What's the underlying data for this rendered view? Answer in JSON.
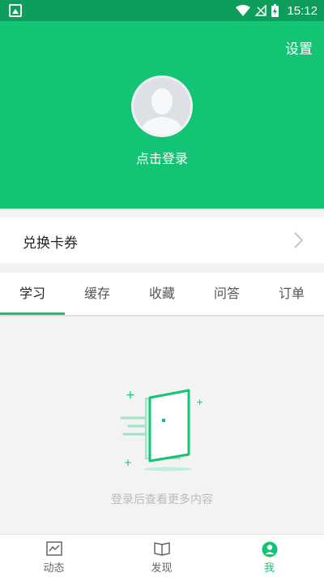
{
  "status_bar": {
    "time": "15:12"
  },
  "header": {
    "settings_label": "设置",
    "login_label": "点击登录"
  },
  "coupon": {
    "label": "兑换卡券"
  },
  "tabs": [
    {
      "label": "学习"
    },
    {
      "label": "缓存"
    },
    {
      "label": "收藏"
    },
    {
      "label": "问答"
    },
    {
      "label": "订单"
    }
  ],
  "active_tab": "学习",
  "empty_state": {
    "message": "登录后查看更多内容"
  },
  "bottom_nav": [
    {
      "label": "动态",
      "icon": "activity-chart-icon"
    },
    {
      "label": "发现",
      "icon": "open-book-icon"
    },
    {
      "label": "我",
      "icon": "user-profile-icon"
    }
  ],
  "active_nav": "我",
  "colors": {
    "brand": "#13c474",
    "status_bar": "#0e9e5c",
    "empty_text": "#bbbbbb"
  }
}
